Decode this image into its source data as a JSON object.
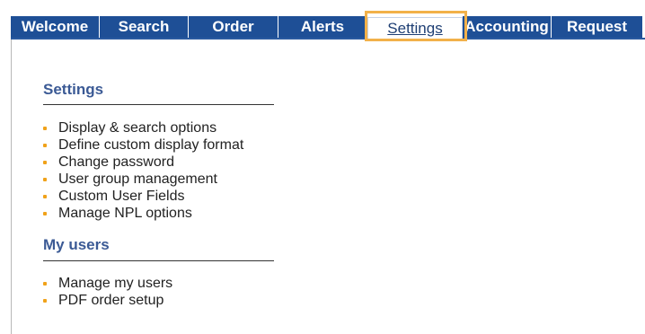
{
  "tabs": [
    {
      "label": "Welcome",
      "active": false
    },
    {
      "label": "Search",
      "active": false
    },
    {
      "label": "Order",
      "active": false
    },
    {
      "label": "Alerts",
      "active": false
    },
    {
      "label": "Settings",
      "active": true
    },
    {
      "label": "Accounting",
      "active": false
    },
    {
      "label": "Request",
      "active": false
    }
  ],
  "settings_section": {
    "title": "Settings",
    "items": [
      "Display & search options",
      "Define custom display format",
      "Change password",
      "User group management",
      "Custom User Fields",
      "Manage NPL options"
    ]
  },
  "my_users_section": {
    "title": "My users",
    "items": [
      "Manage my users",
      "PDF order setup"
    ]
  },
  "colors": {
    "tab_background": "#1e4f96",
    "tab_text": "#ffffff",
    "active_tab_text": "#1f3f74",
    "highlight_border": "#f2b14a",
    "section_title": "#3b5a95",
    "bullet": "#f0a21a"
  },
  "icons": {
    "bullet": "orange-square-bullet"
  }
}
